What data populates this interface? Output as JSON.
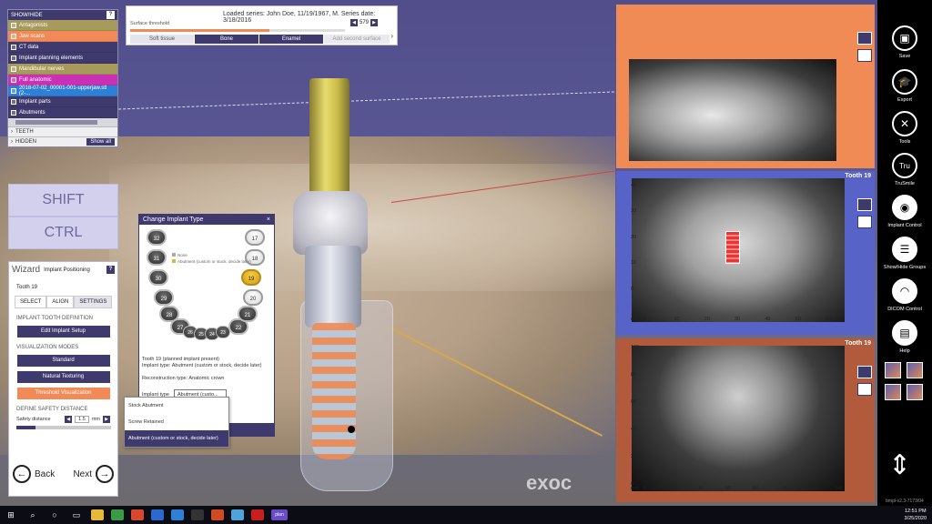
{
  "top_bar": {
    "series_info": "Loaded series: John Doe, 11/19/1967, M. Series date: 3/18/2016",
    "threshold_label": "Surface threshold",
    "threshold_value": "579",
    "threshold_level_pct": 65,
    "segments": [
      "Soft tissue",
      "Bone",
      "Enamel",
      "Add second surface"
    ]
  },
  "show_hide": {
    "title": "SHOW/HIDE",
    "help": "?",
    "items": [
      {
        "label": "Antagonists",
        "color": "#a89a5a"
      },
      {
        "label": "Jaw scans",
        "color": "#f28a57"
      },
      {
        "label": "CT data",
        "color": "#3f3a6e"
      },
      {
        "label": "Implant planning elements",
        "color": "#3f3a6e"
      },
      {
        "label": "Mandibular nerves",
        "color": "#a89a5a"
      },
      {
        "label": "Full anatomic",
        "color": "#c930b5"
      },
      {
        "label": "2018-07-02_00001-001-upperjaw.stl (2-...",
        "color": "#2f7fd6"
      },
      {
        "label": "Implant parts",
        "color": "#3f3a6e"
      },
      {
        "label": "Abutments",
        "color": "#3f3a6e"
      }
    ],
    "teeth_label": "TEETH",
    "hidden_label": "HIDDEN",
    "show_all": "Show all"
  },
  "keys": {
    "shift": "SHIFT",
    "ctrl": "CTRL"
  },
  "wizard": {
    "title": "Wizard",
    "subtitle": "Implant Positioning",
    "help": "?",
    "tooth": "Tooth 19",
    "tabs": [
      "SELECT",
      "ALIGN",
      "SETTINGS"
    ],
    "section1": "IMPLANT TOOTH DEFINITION",
    "edit_setup": "Edit Implant Setup",
    "section2": "VISUALIZATION MODES",
    "modes": [
      "Standard",
      "Natural Texturing",
      "Threshold Visualization"
    ],
    "section3": "DEFINE SAFETY DISTANCE",
    "safety_label": "Safety distance",
    "safety_value": "1.5",
    "safety_unit": "mm",
    "back": "Back",
    "next": "Next"
  },
  "dialog": {
    "title": "Change Implant Type",
    "close": "×",
    "teeth_upper": [
      "32",
      "31",
      "30",
      "29",
      "28",
      "27",
      "26",
      "25",
      "24",
      "23",
      "22",
      "21",
      "20",
      "19",
      "18",
      "17"
    ],
    "legend": [
      "None",
      "Abutment (custom or stock, decide later)"
    ],
    "info1": "Tooth 19 (planned implant present)",
    "info2": "Implant type: Abutment (custom or stock, decide later)",
    "reconstruction": "Reconstruction type: Anatomic crown",
    "type_label": "Implant type",
    "type_value": "Abutment (custo..."
  },
  "dropdown": [
    "Stock Abutment",
    "Screw Retained",
    "Abutment (custom or stock, decide later)"
  ],
  "views": {
    "view2_title": "Tooth 19",
    "view3_title": "Tooth 19",
    "view2_x": [
      "0",
      "10",
      "20",
      "30",
      "40",
      "50",
      "60"
    ],
    "view2_y": [
      "40",
      "30",
      "20",
      "10",
      "0",
      "-10"
    ],
    "view2_unit": "mm",
    "view3_x": [
      "0",
      "20",
      "40",
      "60",
      "80",
      "100",
      "120",
      "140"
    ],
    "view3_y": [
      "100",
      "80",
      "60",
      "40",
      "20",
      "0"
    ],
    "view3_unit": "mm"
  },
  "brand": "exoc",
  "sidebar": {
    "items": [
      {
        "label": "Save",
        "icon": "save-icon"
      },
      {
        "label": "Export",
        "icon": "graduation-cap-icon"
      },
      {
        "label": "Tools",
        "icon": "tools-icon"
      },
      {
        "label": "TruSmile",
        "icon": "trusmile-icon"
      },
      {
        "label": "Implant Control",
        "icon": "eye-icon"
      },
      {
        "label": "Show/Hide Groups",
        "icon": "list-icon"
      },
      {
        "label": "DICOM Control",
        "icon": "dicom-icon"
      },
      {
        "label": "Help",
        "icon": "book-icon"
      }
    ],
    "trusmile_text": "Tru",
    "version": "bmpl-v2.3-7173/04"
  },
  "taskbar": {
    "time": "12:51 PM",
    "date": "3/25/2020",
    "app_label": "plan"
  }
}
